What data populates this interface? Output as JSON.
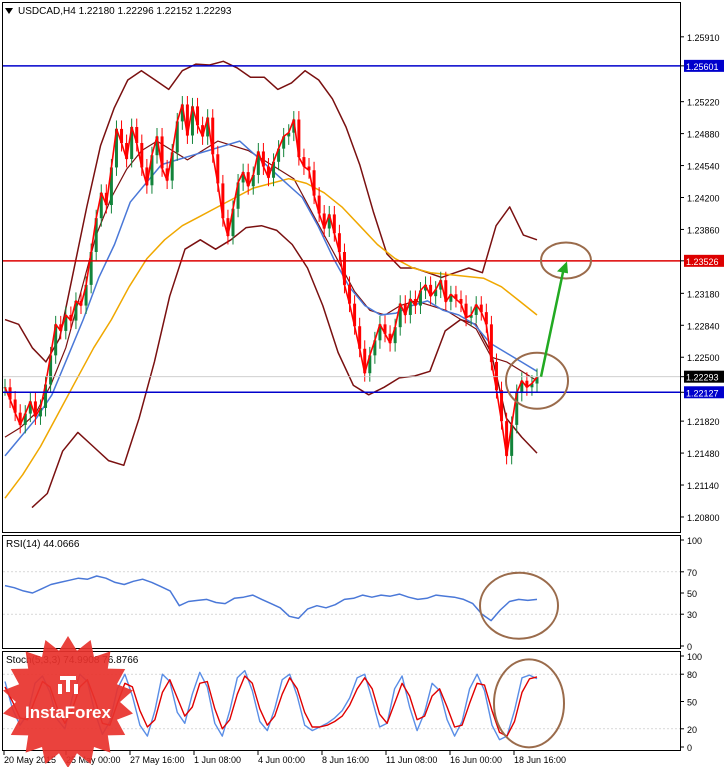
{
  "chart_data": {
    "type": "line",
    "symbol_header": "USDCAD,H4  1.22180 1.22296 1.22152 1.22293",
    "main_panel": {
      "ylim": [
        1.2064,
        1.2627
      ],
      "price_ticks": [
        "1.25910",
        "1.25601",
        "1.25220",
        "1.24880",
        "1.24540",
        "1.24200",
        "1.23860",
        "1.23526",
        "1.23180",
        "1.22840",
        "1.22500",
        "1.22293",
        "1.22127",
        "1.21820",
        "1.21480",
        "1.21140",
        "1.20800"
      ],
      "current_price": {
        "label": "1.22293",
        "value": 1.22293
      },
      "horizontal_levels": [
        {
          "label": "1.25601",
          "value": 1.25601,
          "color": "#0000cc"
        },
        {
          "label": "1.23526",
          "value": 1.23526,
          "color": "#dd0000"
        },
        {
          "label": "1.22127",
          "value": 1.22127,
          "color": "#0000cc"
        }
      ],
      "close_series": [
        1.2218,
        1.2205,
        1.2191,
        1.2178,
        1.219,
        1.2203,
        1.2187,
        1.2196,
        1.2221,
        1.2252,
        1.2285,
        1.2278,
        1.2295,
        1.2289,
        1.231,
        1.2305,
        1.2327,
        1.2362,
        1.2398,
        1.2425,
        1.2412,
        1.2452,
        1.2493,
        1.2478,
        1.2461,
        1.2495,
        1.2478,
        1.2452,
        1.2433,
        1.2465,
        1.2485,
        1.2451,
        1.2438,
        1.2468,
        1.2501,
        1.2519,
        1.2486,
        1.2517,
        1.2497,
        1.2485,
        1.2505,
        1.2466,
        1.2435,
        1.2398,
        1.2379,
        1.2408,
        1.2436,
        1.2447,
        1.2432,
        1.2444,
        1.2469,
        1.2453,
        1.2441,
        1.2458,
        1.2472,
        1.2485,
        1.2489,
        1.2503,
        1.2463,
        1.2453,
        1.2449,
        1.2422,
        1.2403,
        1.2387,
        1.2402,
        1.2382,
        1.2362,
        1.2327,
        1.2307,
        1.2283,
        1.2259,
        1.2233,
        1.2252,
        1.2268,
        1.2285,
        1.2275,
        1.2265,
        1.2282,
        1.2307,
        1.2295,
        1.2312,
        1.2305,
        1.2321,
        1.2327,
        1.2315,
        1.2322,
        1.2332,
        1.2309,
        1.2317,
        1.2312,
        1.2307,
        1.2292,
        1.2295,
        1.2306,
        1.2298,
        1.2285,
        1.2245,
        1.2215,
        1.2182,
        1.2145,
        1.2178,
        1.2212,
        1.2225,
        1.2218,
        1.2222,
        1.2229
      ],
      "mid_band_series": [
        1.2165,
        1.2175,
        1.219,
        1.222,
        1.226,
        1.232,
        1.238,
        1.242,
        1.245,
        1.247,
        1.248,
        1.247,
        1.246,
        1.247,
        1.248,
        1.2475,
        1.247,
        1.246,
        1.245,
        1.244,
        1.241,
        1.238,
        1.235,
        1.232,
        1.23,
        1.2295,
        1.2305,
        1.231,
        1.2305,
        1.23,
        1.229,
        1.228,
        1.225,
        1.2245,
        1.2235,
        1.2225
      ],
      "ma_fast_series": [
        1.2145,
        1.2165,
        1.2185,
        1.221,
        1.225,
        1.229,
        1.2335,
        1.237,
        1.2415,
        1.2435,
        1.2455,
        1.246,
        1.2465,
        1.247,
        1.2475,
        1.248,
        1.2465,
        1.245,
        1.2435,
        1.242,
        1.239,
        1.2355,
        1.2325,
        1.2305,
        1.2295,
        1.2297,
        1.2305,
        1.231,
        1.23,
        1.2295,
        1.2285,
        1.2265,
        1.2255,
        1.2245,
        1.2235
      ],
      "ma_slow_series": [
        1.21,
        1.2125,
        1.2155,
        1.219,
        1.2225,
        1.226,
        1.229,
        1.2325,
        1.2355,
        1.2375,
        1.239,
        1.24,
        1.241,
        1.242,
        1.243,
        1.2435,
        1.244,
        1.2435,
        1.2425,
        1.241,
        1.239,
        1.237,
        1.2355,
        1.2345,
        1.234,
        1.2338,
        1.2336,
        1.2334,
        1.2325,
        1.231,
        1.2295
      ],
      "upper_band_series": [
        1.229,
        1.2285,
        1.226,
        1.2245,
        1.227,
        1.234,
        1.241,
        1.2475,
        1.2515,
        1.2545,
        1.2555,
        1.2545,
        1.2535,
        1.2555,
        1.2562,
        1.2561,
        1.2565,
        1.2558,
        1.2548,
        1.2548,
        1.2535,
        1.2542,
        1.2555,
        1.2545,
        1.2525,
        1.2495,
        1.2455,
        1.2405,
        1.236,
        1.2345,
        1.2345,
        1.234,
        1.2335,
        1.234,
        1.2345,
        1.234,
        1.239,
        1.241,
        1.238,
        1.2375
      ],
      "lower_band_series": [
        1.209,
        1.2105,
        1.215,
        1.217,
        1.2155,
        1.214,
        1.2135,
        1.2185,
        1.2245,
        1.2315,
        1.2365,
        1.2375,
        1.2365,
        1.2375,
        1.2388,
        1.239,
        1.2385,
        1.237,
        1.2345,
        1.2305,
        1.2255,
        1.222,
        1.221,
        1.2218,
        1.2228,
        1.223,
        1.2235,
        1.2278,
        1.229,
        1.2285,
        1.2255,
        1.2185,
        1.2165,
        1.2148
      ],
      "arrow": {
        "from": 1.22293,
        "to": 1.2352,
        "color": "#22aa22"
      }
    },
    "rsi_panel": {
      "header": "RSI(14) 44.0666",
      "ylim": [
        0,
        100
      ],
      "ticks": [
        "100",
        "70",
        "50",
        "30",
        "0"
      ],
      "values": [
        57,
        55,
        52,
        50,
        54,
        58,
        60,
        62,
        64,
        63,
        66,
        64,
        60,
        58,
        61,
        63,
        60,
        56,
        52,
        38,
        42,
        43,
        44,
        41,
        40,
        45,
        46,
        48,
        44,
        40,
        36,
        28,
        26,
        35,
        38,
        36,
        39,
        44,
        45,
        48,
        46,
        48,
        47,
        49,
        46,
        44,
        45,
        48,
        47,
        46,
        44,
        40,
        30,
        24,
        34,
        42,
        44,
        43,
        44
      ]
    },
    "stoch_panel": {
      "header": "Stoch(5,3,3) 74.9908 76.8766",
      "ylim": [
        0,
        100
      ],
      "ticks": [
        "100",
        "80",
        "50",
        "20",
        "0"
      ],
      "main_values": [
        72,
        42,
        24,
        36,
        70,
        78,
        60,
        30,
        20,
        55,
        80,
        72,
        38,
        14,
        28,
        64,
        80,
        56,
        24,
        12,
        40,
        80,
        72,
        38,
        26,
        58,
        82,
        66,
        26,
        12,
        40,
        76,
        84,
        62,
        28,
        18,
        42,
        74,
        80,
        56,
        24,
        18,
        22,
        26,
        32,
        40,
        54,
        76,
        80,
        52,
        22,
        26,
        64,
        78,
        44,
        18,
        38,
        70,
        62,
        30,
        12,
        28,
        64,
        80,
        62,
        24,
        8,
        12,
        40,
        76,
        79,
        75
      ],
      "signal_values": [
        66,
        50,
        32,
        30,
        52,
        72,
        66,
        42,
        26,
        42,
        66,
        74,
        52,
        26,
        24,
        48,
        70,
        66,
        40,
        22,
        30,
        60,
        74,
        54,
        34,
        44,
        70,
        72,
        42,
        20,
        30,
        58,
        78,
        70,
        42,
        24,
        34,
        58,
        76,
        64,
        38,
        22,
        22,
        24,
        28,
        34,
        46,
        64,
        76,
        64,
        36,
        26,
        48,
        70,
        56,
        30,
        34,
        56,
        64,
        44,
        22,
        24,
        48,
        70,
        68,
        40,
        16,
        12,
        28,
        60,
        75,
        77
      ]
    },
    "x_tick_labels": [
      "20 May 2015",
      "25 May 00:00",
      "27 May 16:00",
      "1 Jun 08:00",
      "4 Jun 00:00",
      "8 Jun 16:00",
      "11 Jun 08:00",
      "16 Jun 00:00",
      "18 Jun 16:00"
    ]
  }
}
